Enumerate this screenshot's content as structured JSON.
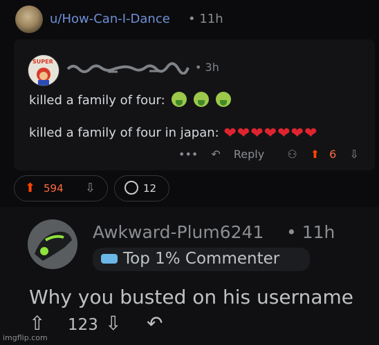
{
  "post": {
    "username": "u/How-Can-I-Dance",
    "time": "• 11h"
  },
  "quoted_comment": {
    "username": "scrambled username",
    "time": "• 3h",
    "line1": "killed a family of four:",
    "line2": "killed a family of four in japan:",
    "sick_emoji_count": 3,
    "heart_count": 7,
    "more": "•••",
    "reply_label": "Reply",
    "votes": "6"
  },
  "post_actions": {
    "votes": "594",
    "comments": "12"
  },
  "reply_comment": {
    "username": "Awkward-Plum6241",
    "time": "• 11h",
    "flair": "Top 1% Commenter",
    "text": "Why you busted on his username",
    "votes": "123"
  },
  "watermark": "imgflip.com",
  "colors": {
    "background": "#0b0b0d",
    "username_blue": "#6f8fd6",
    "upvote_orange": "#ff4500",
    "heart_red": "#e0242f"
  }
}
